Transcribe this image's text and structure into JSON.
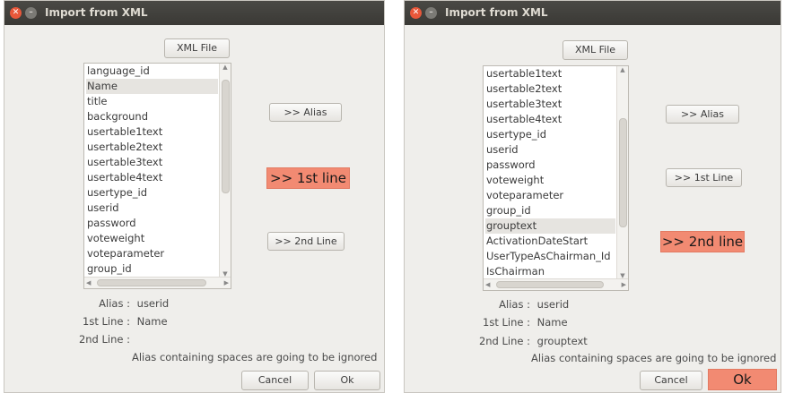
{
  "dialogs": [
    {
      "title": "Import from XML",
      "xml_button": "XML File",
      "list_items": [
        "language_id",
        "Name",
        "title",
        "background",
        "usertable1text",
        "usertable2text",
        "usertable3text",
        "usertable4text",
        "usertype_id",
        "userid",
        "password",
        "voteweight",
        "voteparameter",
        "group_id"
      ],
      "selected_item": "Name",
      "buttons": {
        "alias": ">> Alias",
        "first_line": ">> 1st line",
        "second_line": ">> 2nd Line"
      },
      "alias_label": "Alias :",
      "alias_value": "userid",
      "first_line_label": "1st Line :",
      "first_line_value": "Name",
      "second_line_label": "2nd Line :",
      "second_line_value": "",
      "note": "Alias containing spaces are going to be ignored",
      "cancel_label": "Cancel",
      "ok_label": "Ok"
    },
    {
      "title": "Import from XML",
      "xml_button": "XML File",
      "list_items": [
        "usertable1text",
        "usertable2text",
        "usertable3text",
        "usertable4text",
        "usertype_id",
        "userid",
        "password",
        "voteweight",
        "voteparameter",
        "group_id",
        "grouptext",
        "ActivationDateStart",
        "UserTypeAsChairman_Id",
        "IsChairman"
      ],
      "selected_item": "grouptext",
      "buttons": {
        "alias": ">> Alias",
        "first_line": ">> 1st Line",
        "second_line": ">> 2nd line"
      },
      "alias_label": "Alias :",
      "alias_value": "userid",
      "first_line_label": "1st Line :",
      "first_line_value": "Name",
      "second_line_label": "2nd Line :",
      "second_line_value": "grouptext",
      "note": "Alias containing spaces are going to be ignored",
      "cancel_label": "Cancel",
      "ok_label": "Ok"
    }
  ],
  "highlight_color": "#f28a72"
}
